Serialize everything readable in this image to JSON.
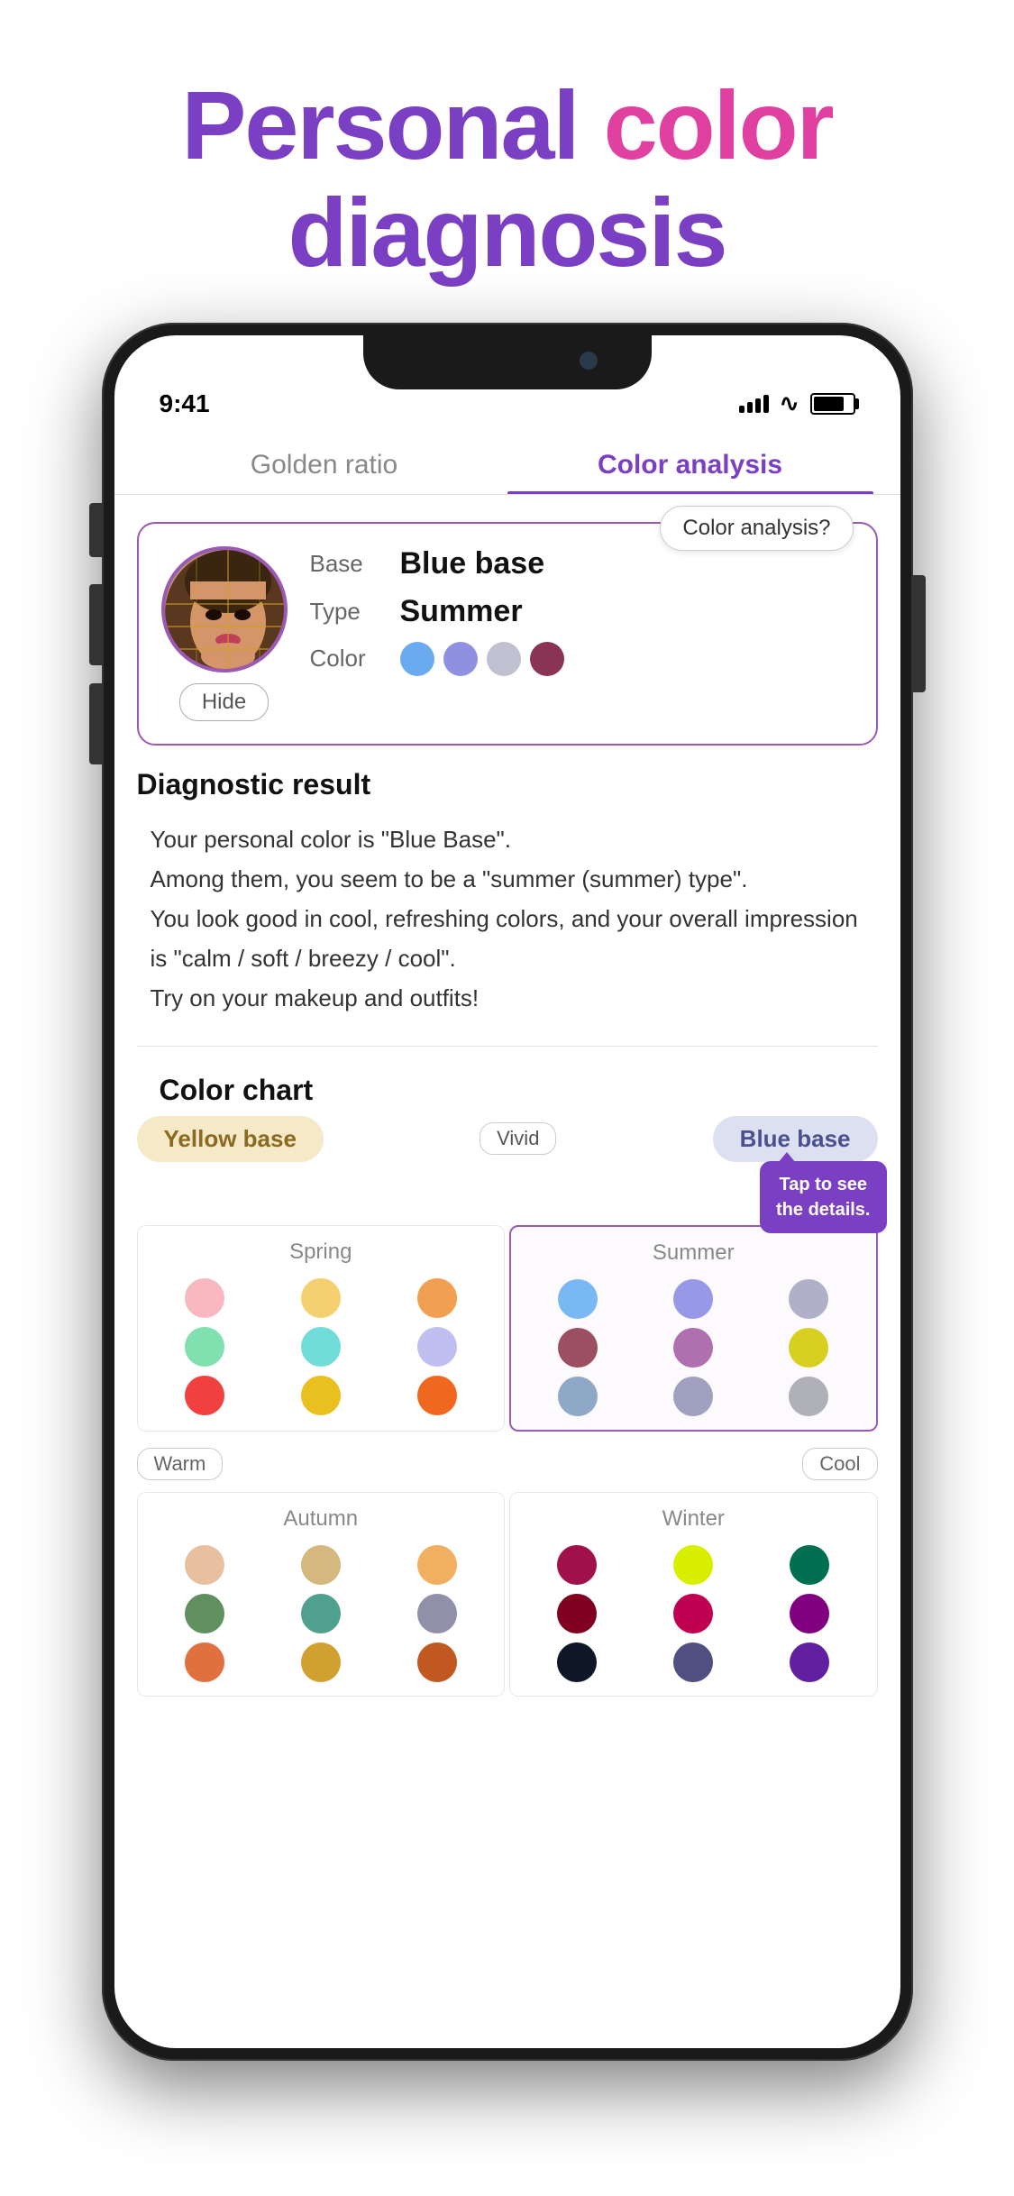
{
  "header": {
    "line1_personal": "Personal",
    "line1_color": " color",
    "line2_diagnosis": "diagnosis"
  },
  "statusBar": {
    "time": "9:41",
    "signal": "●●●●",
    "battery": "80"
  },
  "tabs": [
    {
      "id": "golden-ratio",
      "label": "Golden ratio",
      "active": false
    },
    {
      "id": "color-analysis",
      "label": "Color analysis",
      "active": true
    }
  ],
  "resultCard": {
    "hideLabel": "Hide",
    "base_label": "Base",
    "base_value": "Blue base",
    "type_label": "Type",
    "type_value": "Summer",
    "color_label": "Color",
    "colors": [
      "#6aabf0",
      "#9090e0",
      "#c0c0d0",
      "#8B3355"
    ],
    "analysisBtn": "Color analysis?"
  },
  "diagnostic": {
    "title": "Diagnostic result",
    "text": "Your personal color is \"Blue Base\".\nAmong them, you seem to be a \"summer (summer) type\".\nYou look good in cool, refreshing colors, and your overall impression is \"calm / soft / breezy / cool\".\nTry on your makeup and outfits!"
  },
  "colorChart": {
    "title": "Color chart",
    "yellowBase": "Yellow base",
    "blueBase": "Blue base",
    "vividLabel": "Vivid",
    "tapBubble": "Tap to see\nthe details.",
    "warmLabel": "Warm",
    "coolLabel": "Cool",
    "seasons": {
      "spring": {
        "label": "Spring",
        "dots": [
          "#f9b8c0",
          "#f5d070",
          "#f0a050",
          "#80e0b0",
          "#70ddd8",
          "#c0c0f0",
          "#f04040",
          "#e8c020",
          "#f06820"
        ]
      },
      "summer": {
        "label": "Summer",
        "dots": [
          "#7ab8f5",
          "#9898e8",
          "#b0b0c8",
          "#9a5060",
          "#b070b0",
          "#d8d020",
          "#90a8c8",
          "#a0a0c0",
          "#b0b0b8"
        ]
      },
      "autumn": {
        "label": "Autumn",
        "dots": [
          "#e8c0a0",
          "#d4b880",
          "#f0b060",
          "#609060",
          "#50a090",
          "#9090a8",
          "#e07040",
          "#d0a030",
          "#c05820"
        ]
      },
      "winter": {
        "label": "Winter",
        "dots": [
          "#a0104a",
          "#d8f000",
          "#007050",
          "#800020",
          "#c00050",
          "#800080",
          "#101828",
          "#505080",
          "#6020a0"
        ]
      }
    }
  }
}
